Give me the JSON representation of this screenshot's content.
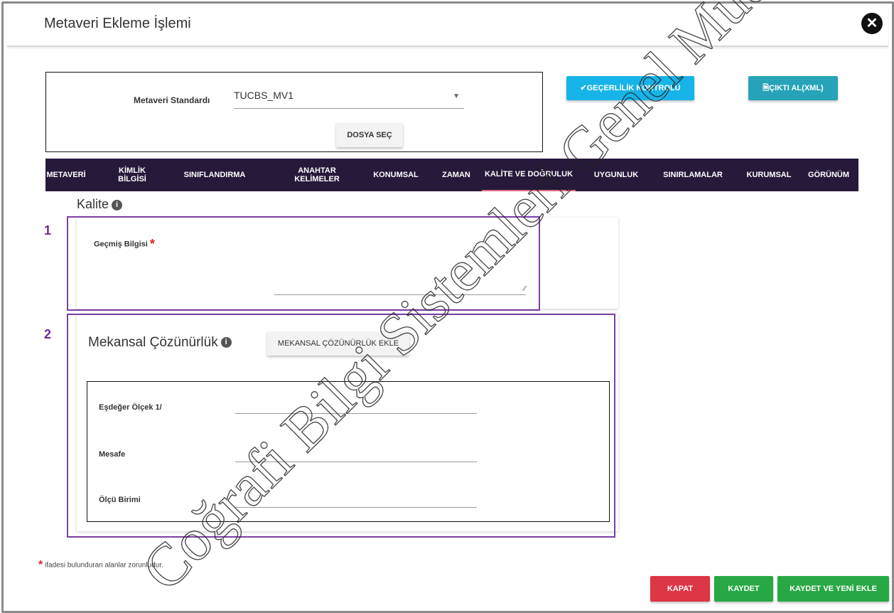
{
  "dialog": {
    "title": "Metaveri Ekleme İşlemi",
    "close_glyph": "✕"
  },
  "standard": {
    "label": "Metaveri Standardı",
    "selected": "TUCBS_MV1",
    "file_button": "DOSYA SEÇ"
  },
  "actions": {
    "validate": "✔GEÇERLİLİK KONTROLÜ",
    "export": "🗎ÇIKTI AL(XML)"
  },
  "tabs": [
    {
      "label": "METAVERİ"
    },
    {
      "label": "KİMLİK BİLGİSİ"
    },
    {
      "label": "SINIFLANDIRMA"
    },
    {
      "label": "ANAHTAR KELİMELER"
    },
    {
      "label": "KONUMSAL"
    },
    {
      "label": "ZAMAN"
    },
    {
      "label": "KALİTE VE DOĞRULUK"
    },
    {
      "label": "UYGUNLUK"
    },
    {
      "label": "SINIRLAMALAR"
    },
    {
      "label": "KURUMSAL"
    },
    {
      "label": "GÖRÜNÜM"
    }
  ],
  "active_tab": "KALİTE VE DOĞRULUK",
  "quality": {
    "title": "Kalite",
    "history_label": "Geçmiş Bilgisi",
    "required_mark": "*"
  },
  "annotations": {
    "one": "1",
    "two": "2"
  },
  "resolution": {
    "title": "Mekansal Çözünürlük",
    "add_button": "MEKANSAL ÇÖZÜNÜRLÜK EKLE",
    "fields": [
      {
        "label": "Eşdeğer Ölçek 1/",
        "value": ""
      },
      {
        "label": "Mesafe",
        "value": ""
      },
      {
        "label": "Ölçü Birimi",
        "value": ""
      }
    ]
  },
  "footnote": {
    "mark": "*",
    "text": " ifadesi bulunduran alanlar zorunludur."
  },
  "footer": {
    "close": "KAPAT",
    "save": "KAYDET",
    "save_new": "KAYDET VE YENİ EKLE"
  },
  "watermark": "Coğrafi Bilgi Sistemleri Genel Müdürlüğü",
  "colors": {
    "tab_bar": "#27193a",
    "highlight": "#7b3fa6",
    "validate_btn": "#16b4e8",
    "export_btn": "#26a3b8",
    "close_btn": "#dc3545",
    "save_btn": "#28a745"
  }
}
